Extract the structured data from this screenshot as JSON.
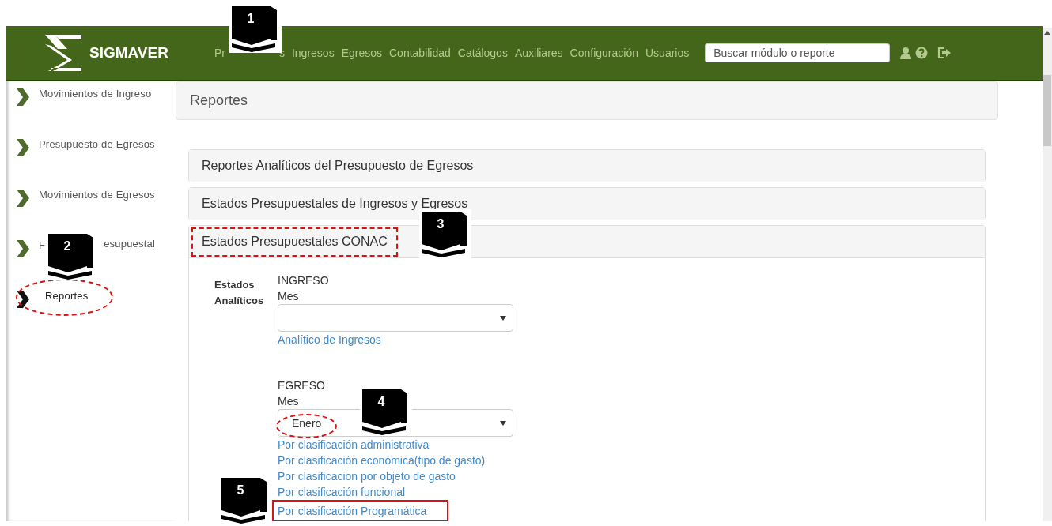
{
  "header": {
    "logo": "SIGMAVER",
    "nav": [
      {
        "label": "Pr",
        "label_end": "s",
        "marker": "1"
      },
      {
        "label": "Ingresos"
      },
      {
        "label": "Egresos"
      },
      {
        "label": "Contabilidad"
      },
      {
        "label": "Catálogos"
      },
      {
        "label": "Auxiliares"
      },
      {
        "label": "Configuración"
      },
      {
        "label": "Usuarios"
      }
    ],
    "search": {
      "placeholder": "Buscar módulo o reporte"
    }
  },
  "sidebar": {
    "items": [
      {
        "label": "Movimientos de Ingreso",
        "selected": false
      },
      {
        "label": "Presupuesto de Egresos",
        "selected": false
      },
      {
        "label": "Movimientos de Egresos",
        "selected": false
      },
      {
        "label": "F",
        "label_end": "esupuestal",
        "selected": false,
        "marker": "2"
      },
      {
        "label": "Reportes",
        "selected": true,
        "circled": true
      }
    ]
  },
  "breadcrumb": "Reportes",
  "accordion": [
    {
      "title": "Reportes Analíticos del Presupuesto de Egresos",
      "expanded": false
    },
    {
      "title": "Estados Presupuestales de Ingresos y Egresos",
      "expanded": false
    },
    {
      "title": "Estados Presupuestales CONAC",
      "expanded": true,
      "dash_boxed": true,
      "marker": "3"
    }
  ],
  "section": {
    "label": "Estados Analíticos",
    "groups": [
      {
        "title": "INGRESO",
        "field_label": "Mes",
        "links": [
          {
            "label": "Analítico de Ingresos"
          }
        ]
      },
      {
        "title": "EGRESO",
        "field_label": "Mes",
        "value": "Enero",
        "circled": true,
        "marker": "4",
        "links": [
          {
            "label": "Por clasificación administrativa"
          },
          {
            "label": "Por clasificación económica(tipo de gasto)"
          },
          {
            "label": "Por clasificacion por objeto de gasto"
          },
          {
            "label": "Por clasificación funcional"
          },
          {
            "label": "Por clasificación Programática",
            "boxed": true,
            "marker": "5"
          }
        ]
      }
    ]
  }
}
